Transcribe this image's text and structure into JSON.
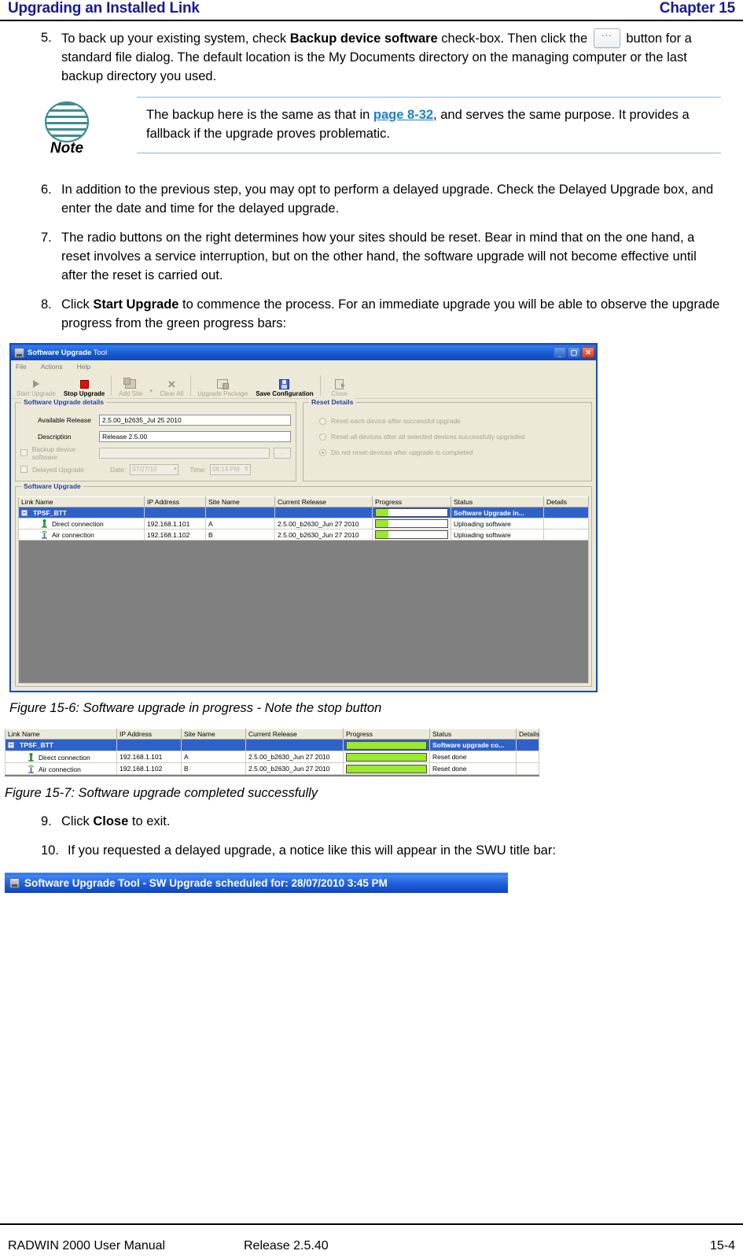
{
  "header": {
    "left": "Upgrading an Installed Link",
    "right": "Chapter 15"
  },
  "steps": [
    {
      "num": "5.",
      "parts": [
        {
          "t": "To back up your existing system, check "
        },
        {
          "t": "Backup device software",
          "bold": true
        },
        {
          "t": " check-box. Then click the "
        },
        {
          "t": "__DOTS_BUTTON__",
          "icon": "ellipsis-button"
        },
        {
          "t": " button for a standard file dialog. The default location is the My Documents directory on the managing computer or the last backup directory you used."
        }
      ]
    },
    {
      "num": "6.",
      "text": "In addition to the previous step, you may opt to perform a delayed upgrade. Check the Delayed Upgrade box, and enter the date and time for the delayed upgrade."
    },
    {
      "num": "7.",
      "text": "The radio buttons on the right determines how your sites should be reset. Bear in mind that on the one hand, a reset involves a service interruption, but on the other hand, the software upgrade will not become effective until after the reset is carried out."
    },
    {
      "num": "8.",
      "parts": [
        {
          "t": "Click "
        },
        {
          "t": "Start Upgrade",
          "bold": true
        },
        {
          "t": " to commence the process. For an immediate upgrade you will be able to observe the upgrade progress from the green progress bars:"
        }
      ]
    }
  ],
  "note": {
    "label": "Note",
    "text_before": "The backup here is the same as that in ",
    "xref": "page 8-32",
    "text_after": ", and serves the same purpose. It provides a fallback if the upgrade proves problematic."
  },
  "steps_after": [
    {
      "num": "9.",
      "parts": [
        {
          "t": "Click "
        },
        {
          "t": "Close",
          "bold": true
        },
        {
          "t": " to exit."
        }
      ]
    },
    {
      "num": "10.",
      "text": "If you requested a delayed upgrade, a notice like this will appear in the SWU title bar:"
    }
  ],
  "app_window": {
    "title": "Software Upgrade Tool",
    "title_bold_part": "Software Upgrade",
    "title_thin_part": " Tool",
    "window_buttons": [
      "minimize",
      "maximize",
      "close"
    ],
    "menu": [
      "File",
      "Actions",
      "Help"
    ],
    "toolbar": [
      {
        "label": "Start Upgrade",
        "icon": "play-icon",
        "enabled": false
      },
      {
        "label": "Stop Upgrade",
        "icon": "stop-icon",
        "enabled": true
      },
      {
        "label": "Add Site",
        "icon": "add-site-icon",
        "enabled": false,
        "has_dropdown": true
      },
      {
        "label": "Clear All",
        "icon": "clear-all-icon",
        "enabled": false
      },
      {
        "label": "Upgrade Package",
        "icon": "package-icon",
        "enabled": false
      },
      {
        "label": "Save Configuration",
        "icon": "save-icon",
        "enabled": true
      },
      {
        "label": "Close",
        "icon": "close-door-icon",
        "enabled": false
      }
    ],
    "details_panel": {
      "title": "Software Upgrade details",
      "available_release_label": "Available Release",
      "available_release_value": "2.5.00_b2635_Jul 25 2010",
      "description_label": "Description",
      "description_value": "Release 2.5.00",
      "backup_checkbox_label": "Backup device software",
      "backup_path_value": "",
      "browse_button_label": "...",
      "delayed_checkbox_label": "Delayed Upgrade",
      "date_label": "Date:",
      "date_value": "07/27/10",
      "time_label": "Time:",
      "time_value": "06:14 PM"
    },
    "reset_panel": {
      "title": "Reset Details",
      "options": [
        {
          "label": "Reset each device after successful upgrade",
          "selected": false
        },
        {
          "label": "Reset all devices after all selected devices successfully upgraded",
          "selected": false
        },
        {
          "label": "Do not reset devices after upgrade is completed",
          "selected": true
        }
      ]
    },
    "grid_panel_title": "Software Upgrade",
    "grid": {
      "columns": [
        "Link Name",
        "IP Address",
        "Site Name",
        "Current Release",
        "Progress",
        "Status",
        "Details"
      ],
      "rows": [
        {
          "type": "group",
          "link_name": "TPSF_BTT",
          "ip": "",
          "site": "",
          "release": "",
          "progress": 18,
          "status": "Software Upgrade in...",
          "details": ""
        },
        {
          "type": "child",
          "icon": "direct-connection-icon",
          "link_name": "Direct connection",
          "ip": "192.168.1.101",
          "site": "A",
          "release": "2.5.00_b2630_Jun 27 2010",
          "progress": 18,
          "status": "Uploading software",
          "details": ""
        },
        {
          "type": "child",
          "icon": "air-connection-icon",
          "link_name": "Air connection",
          "ip": "192.168.1.102",
          "site": "B",
          "release": "2.5.00_b2630_Jun 27 2010",
          "progress": 18,
          "status": "Uploading software",
          "details": ""
        }
      ]
    }
  },
  "figure_6_caption": "Figure 15-6: Software upgrade in progress - Note the stop button",
  "figure_7": {
    "columns": [
      "Link Name",
      "IP Address",
      "Site Name",
      "Current Release",
      "Progress",
      "Status",
      "Details"
    ],
    "rows": [
      {
        "type": "group",
        "link_name": "TPSF_BTT",
        "ip": "",
        "site": "",
        "release": "",
        "progress": 100,
        "status": "Software upgrade co...",
        "details": ""
      },
      {
        "type": "child",
        "icon": "direct-connection-icon",
        "link_name": "Direct connection",
        "ip": "192.168.1.101",
        "site": "A",
        "release": "2.5.00_b2630_Jun 27 2010",
        "progress": 100,
        "status": "Reset done",
        "details": ""
      },
      {
        "type": "child",
        "icon": "air-connection-icon",
        "link_name": "Air connection",
        "ip": "192.168.1.102",
        "site": "B",
        "release": "2.5.00_b2630_Jun 27 2010",
        "progress": 100,
        "status": "Reset done",
        "details": ""
      }
    ]
  },
  "figure_7_caption": "Figure 15-7: Software upgrade completed successfully",
  "swu_title_bar": {
    "text": "Software Upgrade Tool - SW Upgrade scheduled for: 28/07/2010 3:45 PM"
  },
  "footer": {
    "left": "RADWIN 2000 User Manual",
    "middle": "Release  2.5.40",
    "right": "15-4"
  },
  "colors": {
    "heading_blue": "#1a1a8c",
    "xref_blue": "#1a7fd4",
    "title_bar_blue": "#1b5ad2",
    "progress_green": "#9ce82a",
    "selection_blue": "#2f62c8",
    "window_face": "#ece9d8",
    "grid_empty_bg": "#808080",
    "group_label_blue": "#2a3fa0"
  }
}
